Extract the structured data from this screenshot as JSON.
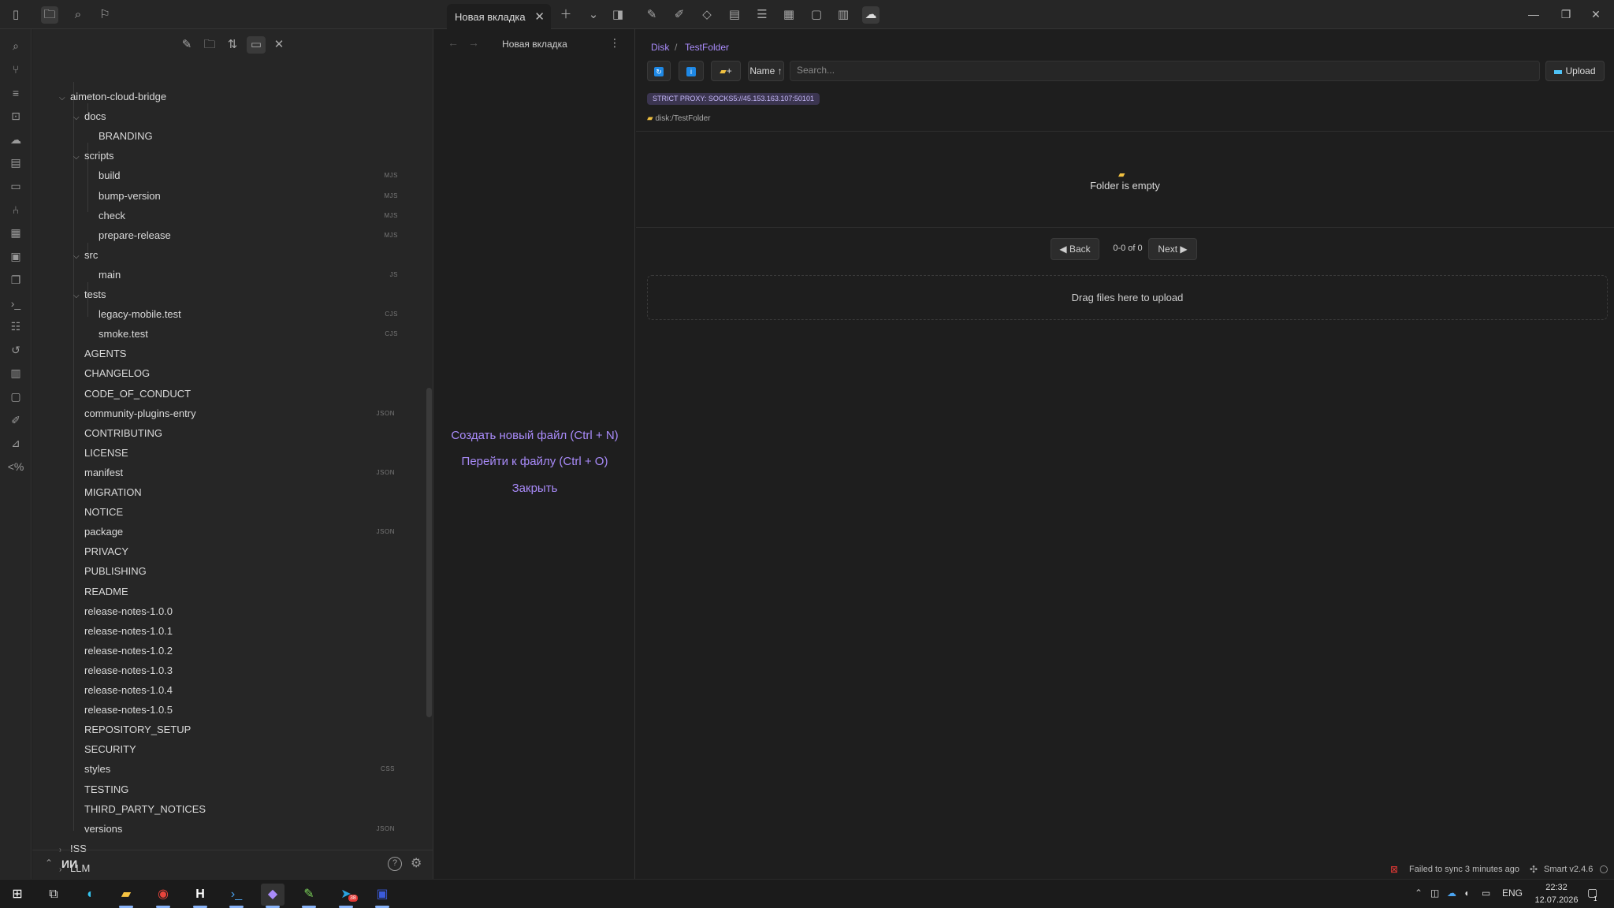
{
  "tab": {
    "title": "Новая вкладка"
  },
  "ribbon": {
    "icons": [
      "search-icon",
      "git-icon",
      "list-icon",
      "graph-icon",
      "cloud-icon",
      "layout-icon",
      "document-icon",
      "branch-icon",
      "grid-icon",
      "calendar-icon",
      "copy-icon",
      "terminal-icon",
      "checklist-icon",
      "history-icon",
      "table-icon",
      "chat-icon",
      "feather-icon",
      "chart-icon",
      "template-icon"
    ]
  },
  "sidebar": {
    "tree": [
      {
        "label": "aimeton-cloud-bridge",
        "level": 0,
        "caret": "open",
        "ext": ""
      },
      {
        "label": "docs",
        "level": 1,
        "caret": "open",
        "ext": ""
      },
      {
        "label": "BRANDING",
        "level": 2,
        "caret": "",
        "ext": ""
      },
      {
        "label": "scripts",
        "level": 1,
        "caret": "open",
        "ext": ""
      },
      {
        "label": "build",
        "level": 2,
        "caret": "",
        "ext": "MJS"
      },
      {
        "label": "bump-version",
        "level": 2,
        "caret": "",
        "ext": "MJS"
      },
      {
        "label": "check",
        "level": 2,
        "caret": "",
        "ext": "MJS"
      },
      {
        "label": "prepare-release",
        "level": 2,
        "caret": "",
        "ext": "MJS"
      },
      {
        "label": "src",
        "level": 1,
        "caret": "open",
        "ext": ""
      },
      {
        "label": "main",
        "level": 2,
        "caret": "",
        "ext": "JS"
      },
      {
        "label": "tests",
        "level": 1,
        "caret": "open",
        "ext": ""
      },
      {
        "label": "legacy-mobile.test",
        "level": 2,
        "caret": "",
        "ext": "CJS"
      },
      {
        "label": "smoke.test",
        "level": 2,
        "caret": "",
        "ext": "CJS"
      },
      {
        "label": "AGENTS",
        "level": 1,
        "caret": "",
        "ext": ""
      },
      {
        "label": "CHANGELOG",
        "level": 1,
        "caret": "",
        "ext": ""
      },
      {
        "label": "CODE_OF_CONDUCT",
        "level": 1,
        "caret": "",
        "ext": ""
      },
      {
        "label": "community-plugins-entry",
        "level": 1,
        "caret": "",
        "ext": "JSON"
      },
      {
        "label": "CONTRIBUTING",
        "level": 1,
        "caret": "",
        "ext": ""
      },
      {
        "label": "LICENSE",
        "level": 1,
        "caret": "",
        "ext": ""
      },
      {
        "label": "manifest",
        "level": 1,
        "caret": "",
        "ext": "JSON"
      },
      {
        "label": "MIGRATION",
        "level": 1,
        "caret": "",
        "ext": ""
      },
      {
        "label": "NOTICE",
        "level": 1,
        "caret": "",
        "ext": ""
      },
      {
        "label": "package",
        "level": 1,
        "caret": "",
        "ext": "JSON"
      },
      {
        "label": "PRIVACY",
        "level": 1,
        "caret": "",
        "ext": ""
      },
      {
        "label": "PUBLISHING",
        "level": 1,
        "caret": "",
        "ext": ""
      },
      {
        "label": "README",
        "level": 1,
        "caret": "",
        "ext": ""
      },
      {
        "label": "release-notes-1.0.0",
        "level": 1,
        "caret": "",
        "ext": ""
      },
      {
        "label": "release-notes-1.0.1",
        "level": 1,
        "caret": "",
        "ext": ""
      },
      {
        "label": "release-notes-1.0.2",
        "level": 1,
        "caret": "",
        "ext": ""
      },
      {
        "label": "release-notes-1.0.3",
        "level": 1,
        "caret": "",
        "ext": ""
      },
      {
        "label": "release-notes-1.0.4",
        "level": 1,
        "caret": "",
        "ext": ""
      },
      {
        "label": "release-notes-1.0.5",
        "level": 1,
        "caret": "",
        "ext": ""
      },
      {
        "label": "REPOSITORY_SETUP",
        "level": 1,
        "caret": "",
        "ext": ""
      },
      {
        "label": "SECURITY",
        "level": 1,
        "caret": "",
        "ext": ""
      },
      {
        "label": "styles",
        "level": 1,
        "caret": "",
        "ext": "CSS"
      },
      {
        "label": "TESTING",
        "level": 1,
        "caret": "",
        "ext": ""
      },
      {
        "label": "THIRD_PARTY_NOTICES",
        "level": 1,
        "caret": "",
        "ext": ""
      },
      {
        "label": "versions",
        "level": 1,
        "caret": "",
        "ext": "JSON"
      },
      {
        "label": "ISS",
        "level": 0,
        "caret": "closed",
        "ext": ""
      },
      {
        "label": "LLM",
        "level": 0,
        "caret": "closed",
        "ext": ""
      }
    ],
    "vault_name": "ИИ"
  },
  "midpane": {
    "title": "Новая вкладка",
    "actions": {
      "new_file": "Создать новый файл (Ctrl + N)",
      "go_to_file": "Перейти к файлу (Ctrl + O)",
      "close": "Закрыть"
    }
  },
  "main": {
    "breadcrumb": {
      "root": "Disk",
      "sep": "/",
      "current": "TestFolder"
    },
    "toolbar": {
      "sort_label": "Name ↑",
      "upload_label": "Upload",
      "new_folder_label": "+"
    },
    "search": {
      "placeholder": "Search..."
    },
    "proxy_badge": "STRICT PROXY: SOCKS5://45.153.163.107:50101",
    "path": "disk:/TestFolder",
    "empty_text": "Folder is empty",
    "pagination": {
      "back": "◀ Back",
      "count": "0-0 of 0",
      "next": "Next ▶"
    },
    "dropzone_text": "Drag files here to upload"
  },
  "statusbar": {
    "sync_text": "Failed to sync 3 minutes ago",
    "plugin_text": "Smart v2.4.6"
  },
  "taskbar": {
    "language": "ENG",
    "time": "22:32",
    "date": "12.07.2026",
    "notification_count": "1",
    "telegram_badge": "38"
  },
  "colors": {
    "accent": "#a98bfa",
    "background": "#1e1e1e",
    "sidebar": "#262626"
  }
}
